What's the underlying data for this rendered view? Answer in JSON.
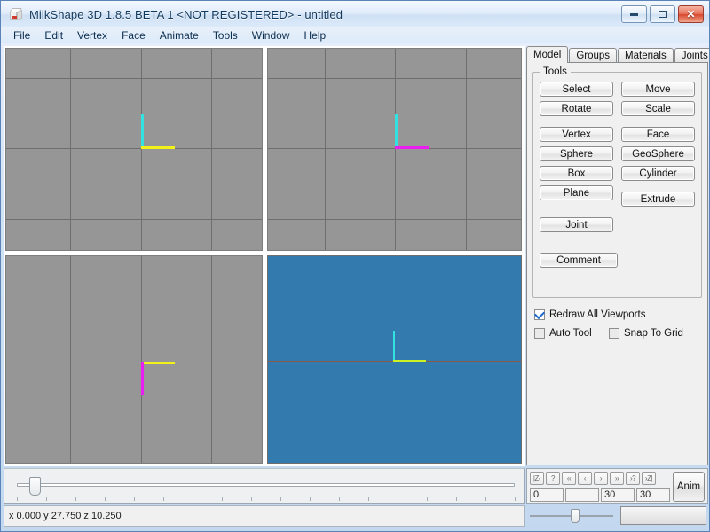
{
  "window": {
    "title": "MilkShape 3D 1.8.5 BETA 1 <NOT REGISTERED> - untitled",
    "icon": "cube-icon",
    "controls": {
      "minimize": "–",
      "maximize": "□",
      "close": "✕"
    }
  },
  "menu": {
    "items": [
      {
        "label": "File"
      },
      {
        "label": "Edit"
      },
      {
        "label": "Vertex"
      },
      {
        "label": "Face"
      },
      {
        "label": "Animate"
      },
      {
        "label": "Tools"
      },
      {
        "label": "Window"
      },
      {
        "label": "Help"
      }
    ]
  },
  "viewports": [
    {
      "name": "front",
      "background": "#969696",
      "grid": true,
      "axes": [
        {
          "name": "y-axis",
          "color": "#33e1e1"
        },
        {
          "name": "x-axis",
          "color": "#f2f21a"
        }
      ]
    },
    {
      "name": "side",
      "background": "#969696",
      "grid": true,
      "axes": [
        {
          "name": "y-axis",
          "color": "#33e1e1"
        },
        {
          "name": "z-axis",
          "color": "#ea1ef0"
        }
      ]
    },
    {
      "name": "top",
      "background": "#969696",
      "grid": true,
      "axes": [
        {
          "name": "x-axis",
          "color": "#f2f21a"
        },
        {
          "name": "z-axis",
          "color": "#ea1ef0"
        }
      ]
    },
    {
      "name": "perspective-3d",
      "background": "#337aaf",
      "grid": false,
      "horizon_color": "#8a5a49",
      "axes": [
        {
          "name": "y-axis",
          "color": "#33e1e1"
        },
        {
          "name": "x-axis",
          "color": "#ccf221"
        }
      ]
    }
  ],
  "panel": {
    "tabs": [
      {
        "label": "Model",
        "active": true
      },
      {
        "label": "Groups",
        "active": false
      },
      {
        "label": "Materials",
        "active": false
      },
      {
        "label": "Joints",
        "active": false
      }
    ],
    "group_title": "Tools",
    "buttons": [
      {
        "label": "Select"
      },
      {
        "label": "Move"
      },
      {
        "label": "Rotate"
      },
      {
        "label": "Scale"
      },
      {
        "label": "Vertex"
      },
      {
        "label": "Face"
      },
      {
        "label": "Sphere"
      },
      {
        "label": "GeoSphere"
      },
      {
        "label": "Box"
      },
      {
        "label": "Cylinder"
      },
      {
        "label": "Plane"
      },
      {
        "label": "Extrude"
      },
      {
        "label": "Joint"
      }
    ],
    "comment_label": "Comment",
    "checkboxes": [
      {
        "label": "Redraw All Viewports",
        "checked": true
      },
      {
        "label": "Auto Tool",
        "checked": false
      },
      {
        "label": "Snap To Grid",
        "checked": false
      }
    ]
  },
  "timeline": {
    "value": 0,
    "thumb_position_percent": 2
  },
  "anim": {
    "transport": [
      {
        "name": "go-to-start-key-button",
        "glyph": "|Z‹"
      },
      {
        "name": "prev-key-button",
        "glyph": "?"
      },
      {
        "name": "rewind-button",
        "glyph": "‹‹"
      },
      {
        "name": "step-back-button",
        "glyph": "‹"
      },
      {
        "name": "step-forward-button",
        "glyph": "›"
      },
      {
        "name": "fast-forward-button",
        "glyph": "››"
      },
      {
        "name": "next-key-button",
        "glyph": "›?"
      },
      {
        "name": "go-to-end-key-button",
        "glyph": "›Z|"
      }
    ],
    "fields": [
      {
        "name": "current-frame-field",
        "value": "0"
      },
      {
        "name": "keyframe-field",
        "value": ""
      },
      {
        "name": "total-frames-field",
        "value": "30"
      },
      {
        "name": "fps-field",
        "value": "30"
      }
    ],
    "anim_button_label": "Anim"
  },
  "statusbar": {
    "coordinates": "x 0.000 y 27.750 z 10.250"
  },
  "bottom_right": {
    "slider_position_percent": 48
  },
  "colors": {
    "viewport_gray": "#969696",
    "viewport_grid": "#6e6e6e",
    "viewport_3d": "#337aaf",
    "axis_y": "#33e1e1",
    "axis_x": "#f2f21a",
    "axis_z": "#ea1ef0",
    "panel_bg": "#f0f0f0",
    "title_text": "#12395e"
  }
}
